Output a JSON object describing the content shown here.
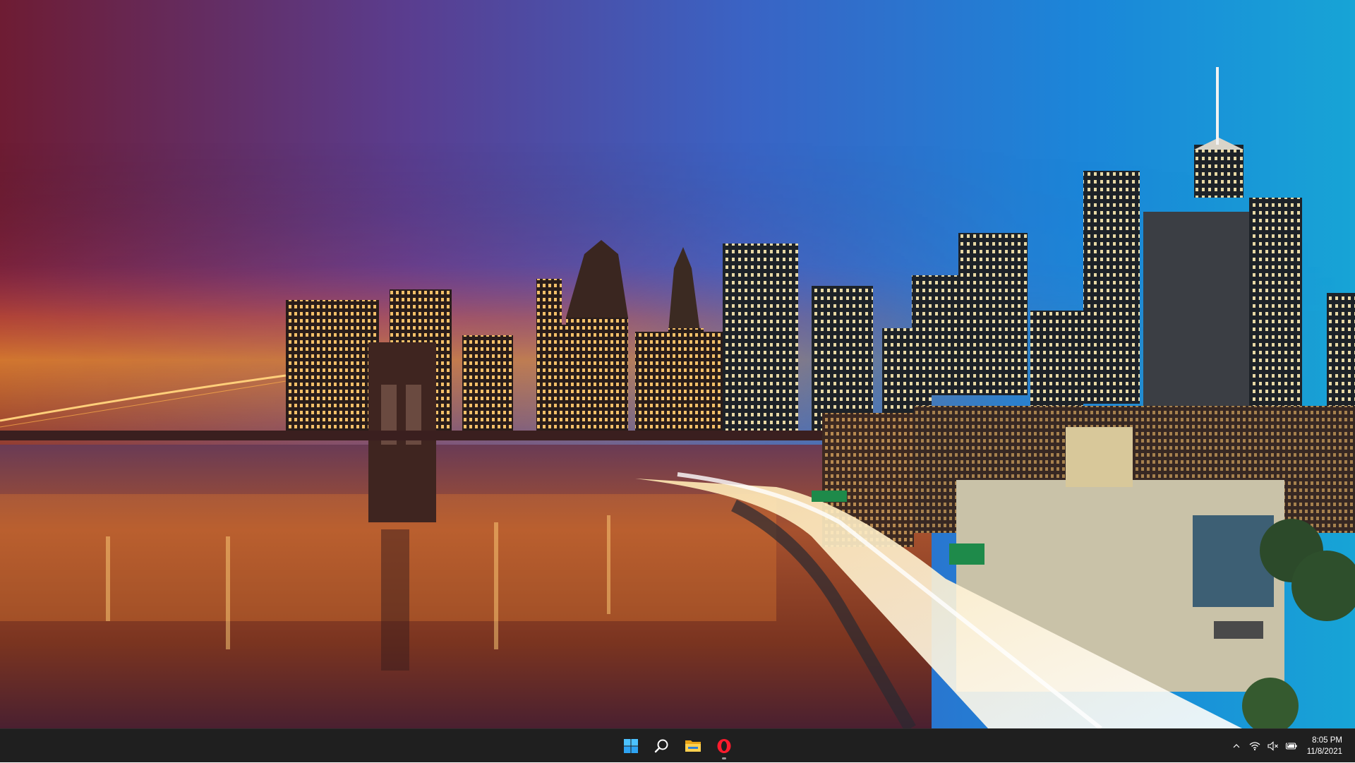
{
  "wallpaper": {
    "description_colors": {
      "sky_left": "#7a2035",
      "sky_mid": "#6b4fa0",
      "sky_right": "#1aa3d9",
      "horizon_glow": "#f07a2a",
      "water": "#b8552a",
      "city_lights": "#ffd27a"
    }
  },
  "taskbar": {
    "background": "#1f1f1f",
    "apps": [
      {
        "icon": "windows-start-icon",
        "running": false
      },
      {
        "icon": "search-icon",
        "running": false
      },
      {
        "icon": "file-explorer-icon",
        "running": false
      },
      {
        "icon": "opera-browser-icon",
        "running": true
      }
    ],
    "tray": {
      "chevron_icon": "chevron-up-icon",
      "wifi_icon": "wifi-icon",
      "volume_icon": "volume-muted-icon",
      "battery_icon": "battery-charging-icon"
    },
    "clock": {
      "time": "8:05 PM",
      "date": "11/8/2021"
    }
  }
}
